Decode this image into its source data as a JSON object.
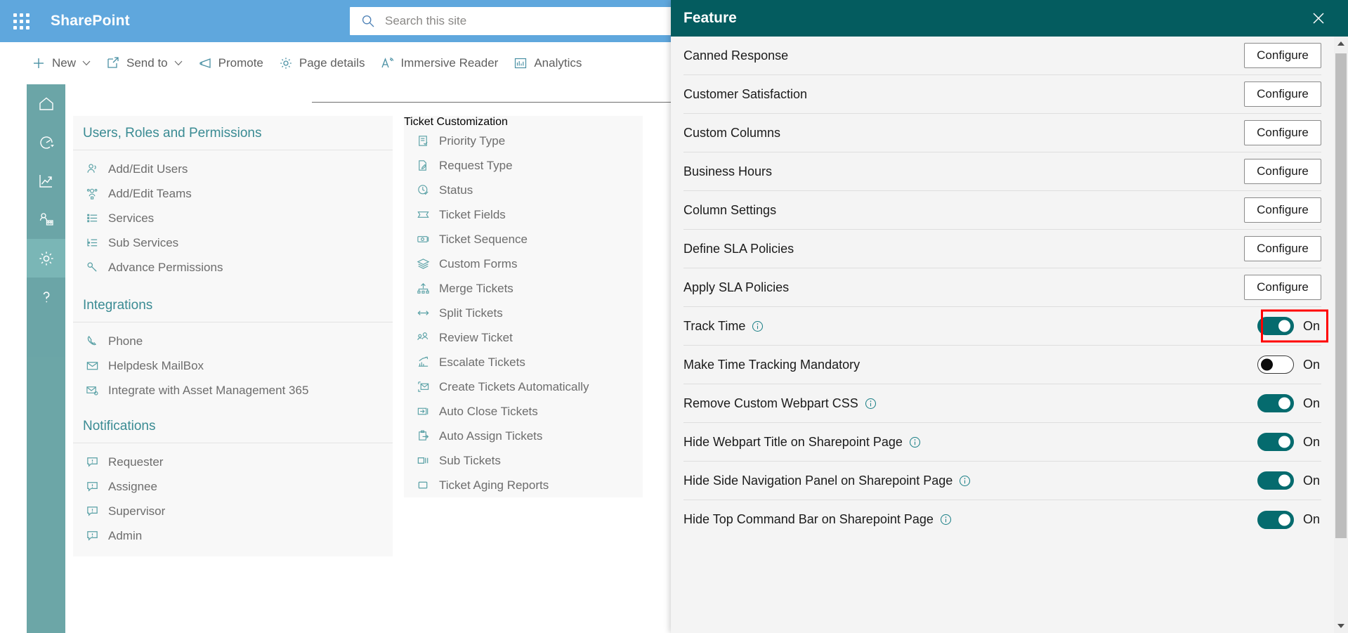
{
  "suite": {
    "waffle_icon": "app-launcher-icon",
    "brand": "SharePoint",
    "search": {
      "placeholder": "Search this site",
      "icon": "search-icon"
    }
  },
  "command_bar": {
    "items": [
      {
        "label": "New",
        "icon": "plus-icon",
        "has_chevron": true
      },
      {
        "label": "Send to",
        "icon": "send-to-icon",
        "has_chevron": true
      },
      {
        "label": "Promote",
        "icon": "megaphone-icon",
        "has_chevron": false
      },
      {
        "label": "Page details",
        "icon": "gear-icon",
        "has_chevron": false
      },
      {
        "label": "Immersive Reader",
        "icon": "immersive-reader-icon",
        "has_chevron": false
      },
      {
        "label": "Analytics",
        "icon": "analytics-icon",
        "has_chevron": false
      }
    ]
  },
  "rail": {
    "items": [
      {
        "name": "home",
        "icon": "home-icon",
        "active": false
      },
      {
        "name": "dashboard",
        "icon": "speedometer-icon",
        "active": false
      },
      {
        "name": "reports",
        "icon": "line-chart-icon",
        "active": false
      },
      {
        "name": "teams",
        "icon": "people-board-icon",
        "active": false
      },
      {
        "name": "settings",
        "icon": "gear-icon",
        "active": true
      },
      {
        "name": "help",
        "icon": "question-mark-icon",
        "active": false
      }
    ]
  },
  "settings_columns": [
    {
      "title": "Users, Roles and Permissions",
      "items": [
        {
          "label": "Add/Edit Users",
          "icon": "users-icon"
        },
        {
          "label": "Add/Edit Teams",
          "icon": "team-icon"
        },
        {
          "label": "Services",
          "icon": "list-icon"
        },
        {
          "label": "Sub Services",
          "icon": "sub-list-icon"
        },
        {
          "label": "Advance Permissions",
          "icon": "key-icon"
        }
      ]
    },
    {
      "title": "Integrations",
      "items": [
        {
          "label": "Phone",
          "icon": "phone-icon"
        },
        {
          "label": "Helpdesk MailBox",
          "icon": "mail-icon"
        },
        {
          "label": "Integrate with Asset Management 365",
          "icon": "mail-gear-icon"
        }
      ]
    },
    {
      "title": "Notifications",
      "items": [
        {
          "label": "Requester",
          "icon": "comment-alert-icon"
        },
        {
          "label": "Assignee",
          "icon": "comment-alert-icon"
        },
        {
          "label": "Supervisor",
          "icon": "comment-alert-icon"
        },
        {
          "label": "Admin",
          "icon": "comment-alert-icon"
        }
      ]
    }
  ],
  "ticket_customization": {
    "title": "Ticket Customization",
    "items": [
      {
        "label": "Priority Type",
        "icon": "clipboard-check-icon"
      },
      {
        "label": "Request Type",
        "icon": "page-edit-icon"
      },
      {
        "label": "Status",
        "icon": "clock-check-icon"
      },
      {
        "label": "Ticket Fields",
        "icon": "ticket-icon"
      },
      {
        "label": "Ticket Sequence",
        "icon": "sequence-icon"
      },
      {
        "label": "Custom Forms",
        "icon": "layers-icon"
      },
      {
        "label": "Merge Tickets",
        "icon": "merge-icon"
      },
      {
        "label": "Split Tickets",
        "icon": "split-arrows-icon"
      },
      {
        "label": "Review Ticket",
        "icon": "review-people-icon"
      },
      {
        "label": "Escalate Tickets",
        "icon": "escalate-chart-icon"
      },
      {
        "label": "Create Tickets Automatically",
        "icon": "auto-mail-icon"
      },
      {
        "label": "Auto Close Tickets",
        "icon": "auto-close-icon"
      },
      {
        "label": "Auto Assign Tickets",
        "icon": "clipboard-arrow-icon"
      },
      {
        "label": "Sub Tickets",
        "icon": "sub-tickets-icon"
      },
      {
        "label": "Ticket Aging Reports",
        "icon": "square-icon"
      }
    ]
  },
  "feature_panel": {
    "title": "Feature",
    "close_icon": "close-icon",
    "configure_label": "Configure",
    "rows": [
      {
        "label": "Canned Response",
        "control": "button"
      },
      {
        "label": "Customer Satisfaction",
        "control": "button"
      },
      {
        "label": "Custom Columns",
        "control": "button"
      },
      {
        "label": "Business Hours",
        "control": "button"
      },
      {
        "label": "Column Settings",
        "control": "button"
      },
      {
        "label": "Define SLA Policies",
        "control": "button"
      },
      {
        "label": "Apply SLA Policies",
        "control": "button"
      },
      {
        "label": "Track Time",
        "control": "toggle",
        "state": "On",
        "on": true,
        "info": true,
        "highlighted": true
      },
      {
        "label": "Make Time Tracking Mandatory",
        "control": "toggle",
        "state": "On",
        "on": false,
        "info": false,
        "highlighted": false
      },
      {
        "label": "Remove Custom Webpart CSS",
        "control": "toggle",
        "state": "On",
        "on": true,
        "info": true,
        "highlighted": false
      },
      {
        "label": "Hide Webpart Title on Sharepoint Page",
        "control": "toggle",
        "state": "On",
        "on": true,
        "info": true,
        "highlighted": false
      },
      {
        "label": "Hide Side Navigation Panel on Sharepoint Page",
        "control": "toggle",
        "state": "On",
        "on": true,
        "info": true,
        "highlighted": false
      },
      {
        "label": "Hide Top Command Bar on Sharepoint Page",
        "control": "toggle",
        "state": "On",
        "on": true,
        "info": true,
        "highlighted": false
      }
    ],
    "scrollbar": {
      "up_icon": "scroll-up-arrow-icon",
      "down_icon": "scroll-down-arrow-icon"
    }
  },
  "colors": {
    "suite_bar": "#5fa7dd",
    "panel_header": "#045c5f",
    "rail": "#5f9ea0",
    "accent_teal": "#3a8b93",
    "toggle_on": "#056b6e",
    "highlight": "#ff0000"
  }
}
